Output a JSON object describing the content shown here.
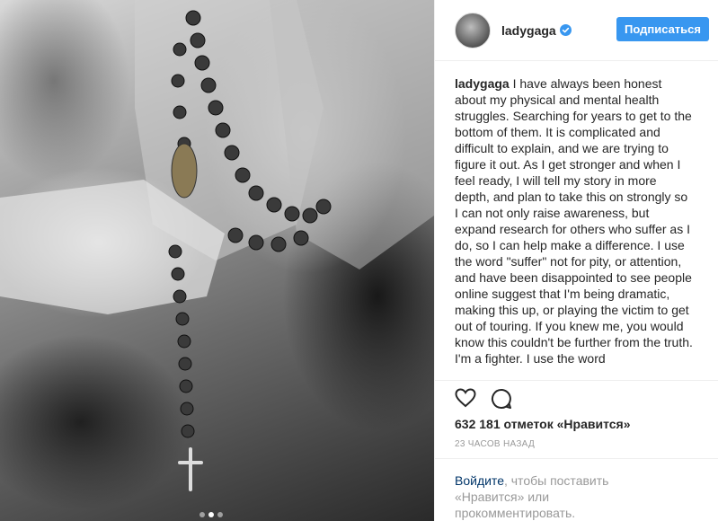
{
  "post": {
    "username": "ladygaga",
    "verified_icon": "verified-badge-icon",
    "follow_label": "Подписаться",
    "caption_text": "I have always been honest about my physical and mental health struggles. Searching for years to get to the bottom of them. It is complicated and difficult to explain, and we are trying to figure it out. As I get stronger and when I feel ready, I will tell my story in more depth, and plan to take this on strongly so I can not only raise awareness, but expand research for others who suffer as I do, so I can help make a difference. I use the word \"suffer\" not for pity, or attention, and have been disappointed to see people online suggest that I'm being dramatic, making this up, or playing the victim to get out of touring. If you knew me, you would know this couldn't be further from the truth. I'm a fighter. I use the word",
    "likes": "632 181 отметок «Нравится»",
    "time": "23 ЧАСОВ НАЗАД",
    "login_link": "Войдите",
    "login_text": ", чтобы поставить «Нравится» или прокомментировать.",
    "icons": [
      "heart-icon",
      "comment-icon"
    ],
    "carousel": {
      "count": 3,
      "active": 1
    }
  },
  "colors": {
    "accent": "#3897f0",
    "link": "#003569",
    "muted": "#999999"
  }
}
